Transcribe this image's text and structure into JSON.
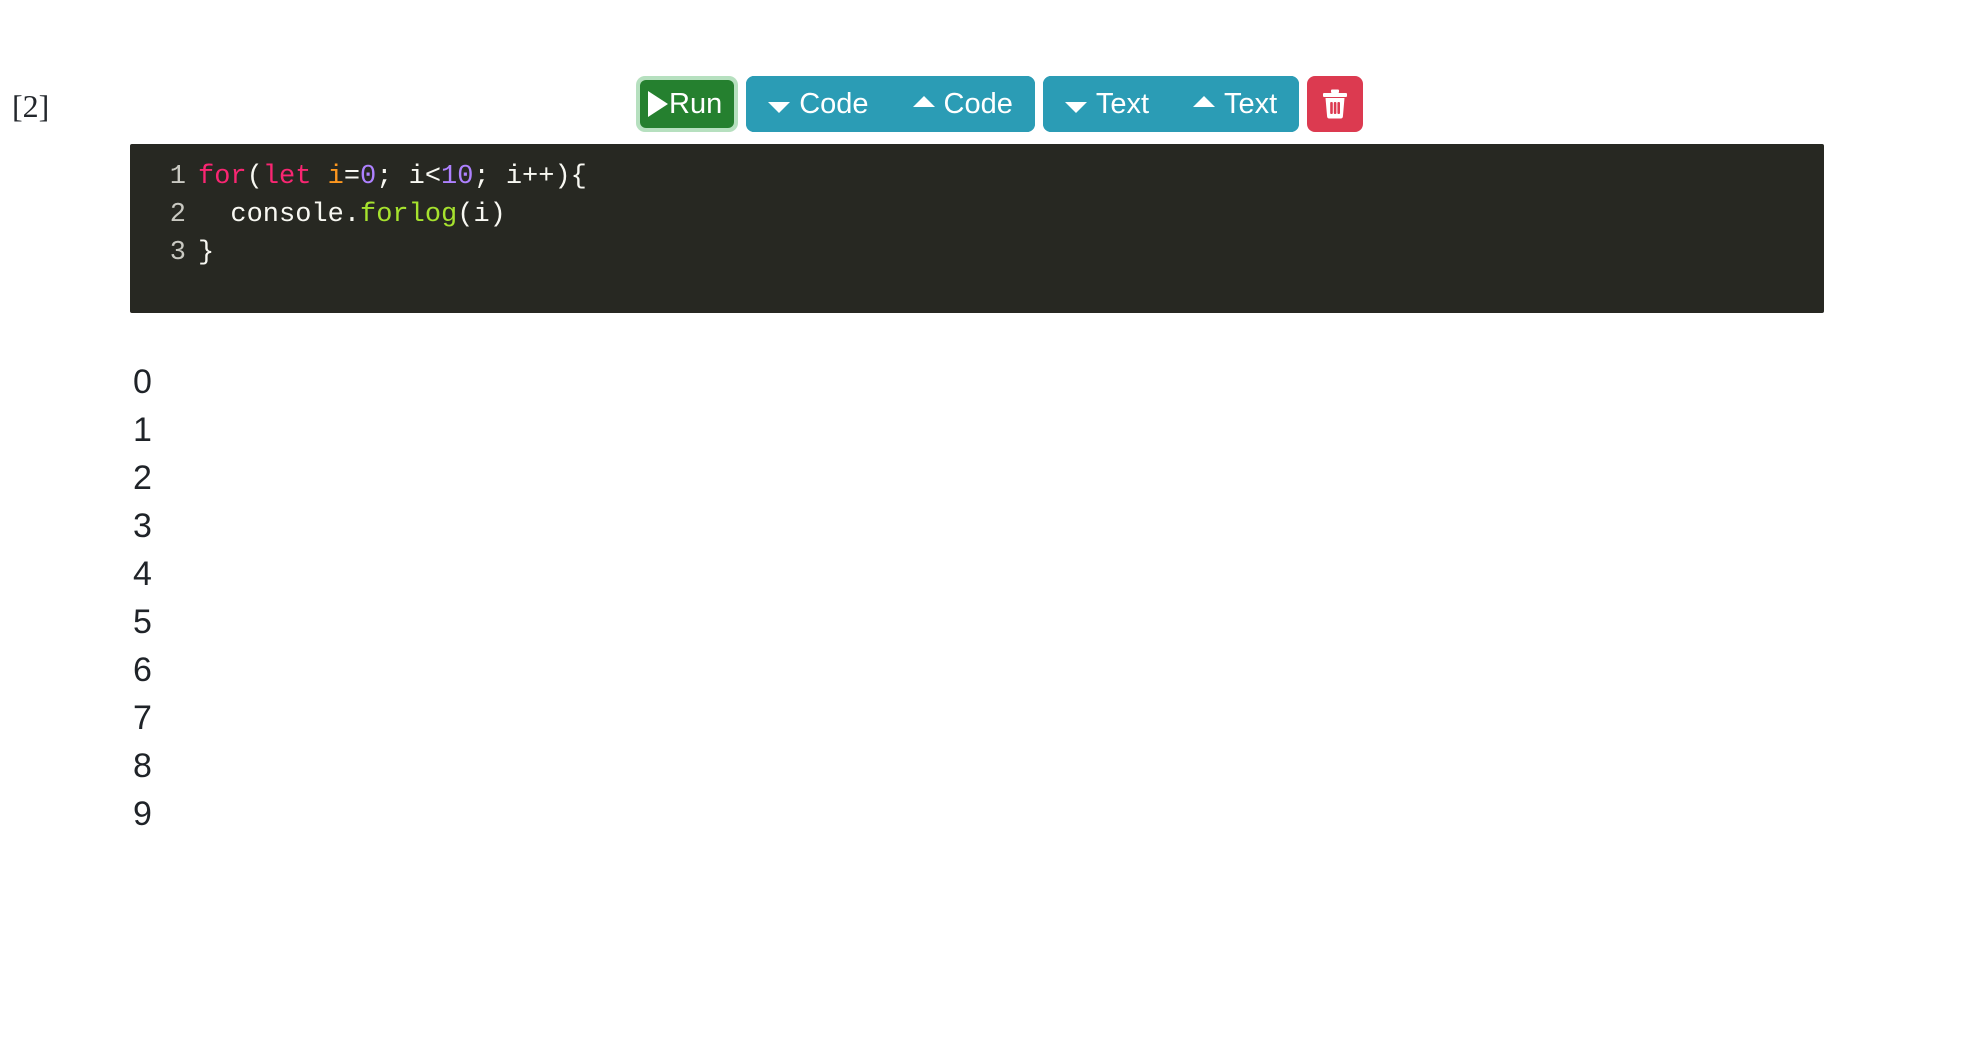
{
  "cell": {
    "execution_counter": "[2]",
    "previous_output_tail": "9"
  },
  "toolbar": {
    "run": {
      "label": "Run",
      "icon": "play-icon",
      "color": "#25802f",
      "focus_ring": "#b6e0bf"
    },
    "group_color": "#2b9cb5",
    "code_below": {
      "label": "Code",
      "icon": "caret-down-icon"
    },
    "code_above": {
      "label": "Code",
      "icon": "caret-up-icon"
    },
    "text_below": {
      "label": "Text",
      "icon": "caret-down-icon"
    },
    "text_above": {
      "label": "Text",
      "icon": "caret-up-icon"
    },
    "delete": {
      "label": "",
      "icon": "trash-icon",
      "color": "#dc3a50"
    }
  },
  "editor": {
    "background": "#272822",
    "lines": [
      {
        "number": "1",
        "tokens": [
          {
            "text": "for",
            "type": "kw"
          },
          {
            "text": "(",
            "type": "pl"
          },
          {
            "text": "let",
            "type": "kw"
          },
          {
            "text": " ",
            "type": "pl"
          },
          {
            "text": "i",
            "type": "var"
          },
          {
            "text": "=",
            "type": "pl"
          },
          {
            "text": "0",
            "type": "num"
          },
          {
            "text": "; i<",
            "type": "pl"
          },
          {
            "text": "10",
            "type": "num"
          },
          {
            "text": "; i++){",
            "type": "pl"
          }
        ]
      },
      {
        "number": "2",
        "tokens": [
          {
            "text": "  console.",
            "type": "pl"
          },
          {
            "text": "forlog",
            "type": "fn"
          },
          {
            "text": "(i)",
            "type": "pl"
          }
        ]
      },
      {
        "number": "3",
        "tokens": [
          {
            "text": "}",
            "type": "pl"
          }
        ]
      }
    ]
  },
  "output": {
    "lines": [
      "0",
      "1",
      "2",
      "3",
      "4",
      "5",
      "6",
      "7",
      "8",
      "9"
    ]
  }
}
